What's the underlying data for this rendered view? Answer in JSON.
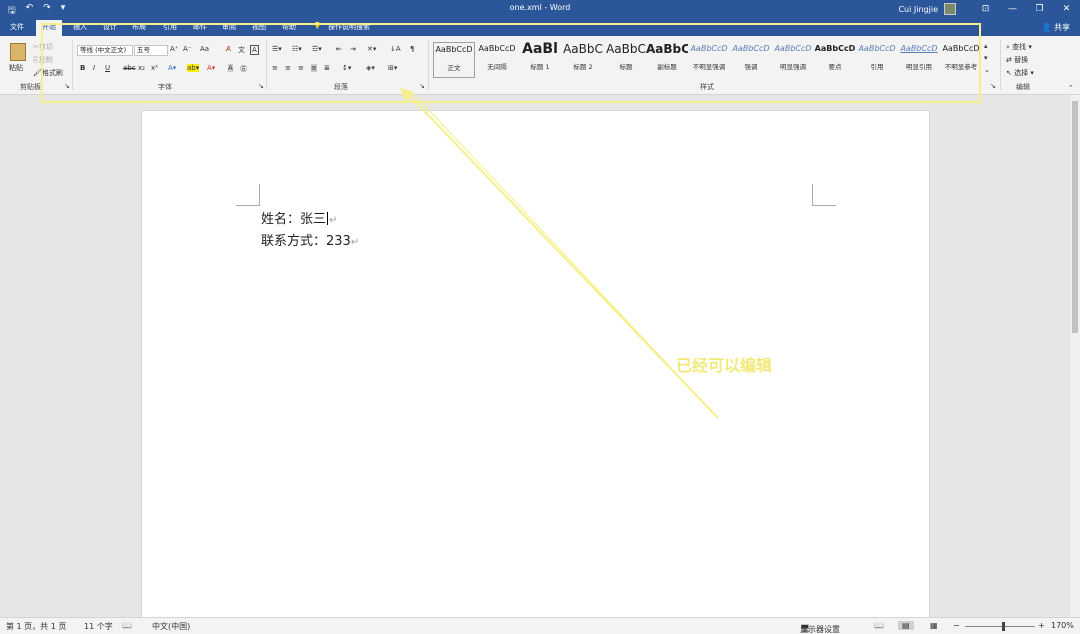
{
  "titlebar": {
    "qat": [
      "🖫",
      "↶",
      "↷",
      "▾"
    ],
    "doc_title": "one.xml  -  Word",
    "user_name": "Cui Jingjie",
    "win_buttons": [
      "⊡",
      "—",
      "❐",
      "✕"
    ]
  },
  "tabs": [
    "文件",
    "开始",
    "插入",
    "设计",
    "布局",
    "引用",
    "邮件",
    "审阅",
    "视图",
    "帮助",
    "操作说明搜索"
  ],
  "share": "共享",
  "clipboard": {
    "paste": "粘贴",
    "cut": "剪切",
    "copy": "复制",
    "format_painter": "格式刷",
    "group_label": "剪贴板"
  },
  "font": {
    "font_name": "等线 (中文正文)",
    "font_size": "五号",
    "grow": "A⁺",
    "shrink": "A⁻",
    "change_case": "Aa",
    "bold": "B",
    "italic": "I",
    "underline": "U",
    "strike": "abc",
    "subscript": "x₂",
    "superscript": "x²",
    "group_label": "字体"
  },
  "paragraph": {
    "group_label": "段落"
  },
  "styles": {
    "items": [
      {
        "sample": "AaBbCcD",
        "name": "正文"
      },
      {
        "sample": "AaBbCcD",
        "name": "无间隔"
      },
      {
        "sample": "AaBl",
        "name": "标题 1"
      },
      {
        "sample": "AaBbC",
        "name": "标题 2"
      },
      {
        "sample": "AaBbC",
        "name": "标题"
      },
      {
        "sample": "AaBbC",
        "name": "副标题"
      },
      {
        "sample": "AaBbCcD",
        "name": "不明显强调"
      },
      {
        "sample": "AaBbCcD",
        "name": "强调"
      },
      {
        "sample": "AaBbCcD",
        "name": "明显强调"
      },
      {
        "sample": "AaBbCcD",
        "name": "要点"
      },
      {
        "sample": "AaBbCcD",
        "name": "引用"
      },
      {
        "sample": "AaBbCcD",
        "name": "明显引用"
      },
      {
        "sample": "AaBbCcD",
        "name": "不明显参考"
      }
    ],
    "group_label": "样式"
  },
  "editing": {
    "find": "查找",
    "replace": "替换",
    "select": "选择",
    "group_label": "编辑"
  },
  "document": {
    "line1": "姓名：张三",
    "line2": "联系方式：233",
    "para_mark": "↵"
  },
  "annotation": {
    "text": "已经可以编辑",
    "color": "#f2e97a"
  },
  "status": {
    "page": "第 1 页，共 1 页",
    "words": "11 个字",
    "language": "中文(中国)",
    "display_settings": "显示器设置",
    "zoom": "170%"
  },
  "colors": {
    "title_bar": "#2b579a",
    "ribbon": "#f3f3f3",
    "highlight": "#f5f08a"
  }
}
